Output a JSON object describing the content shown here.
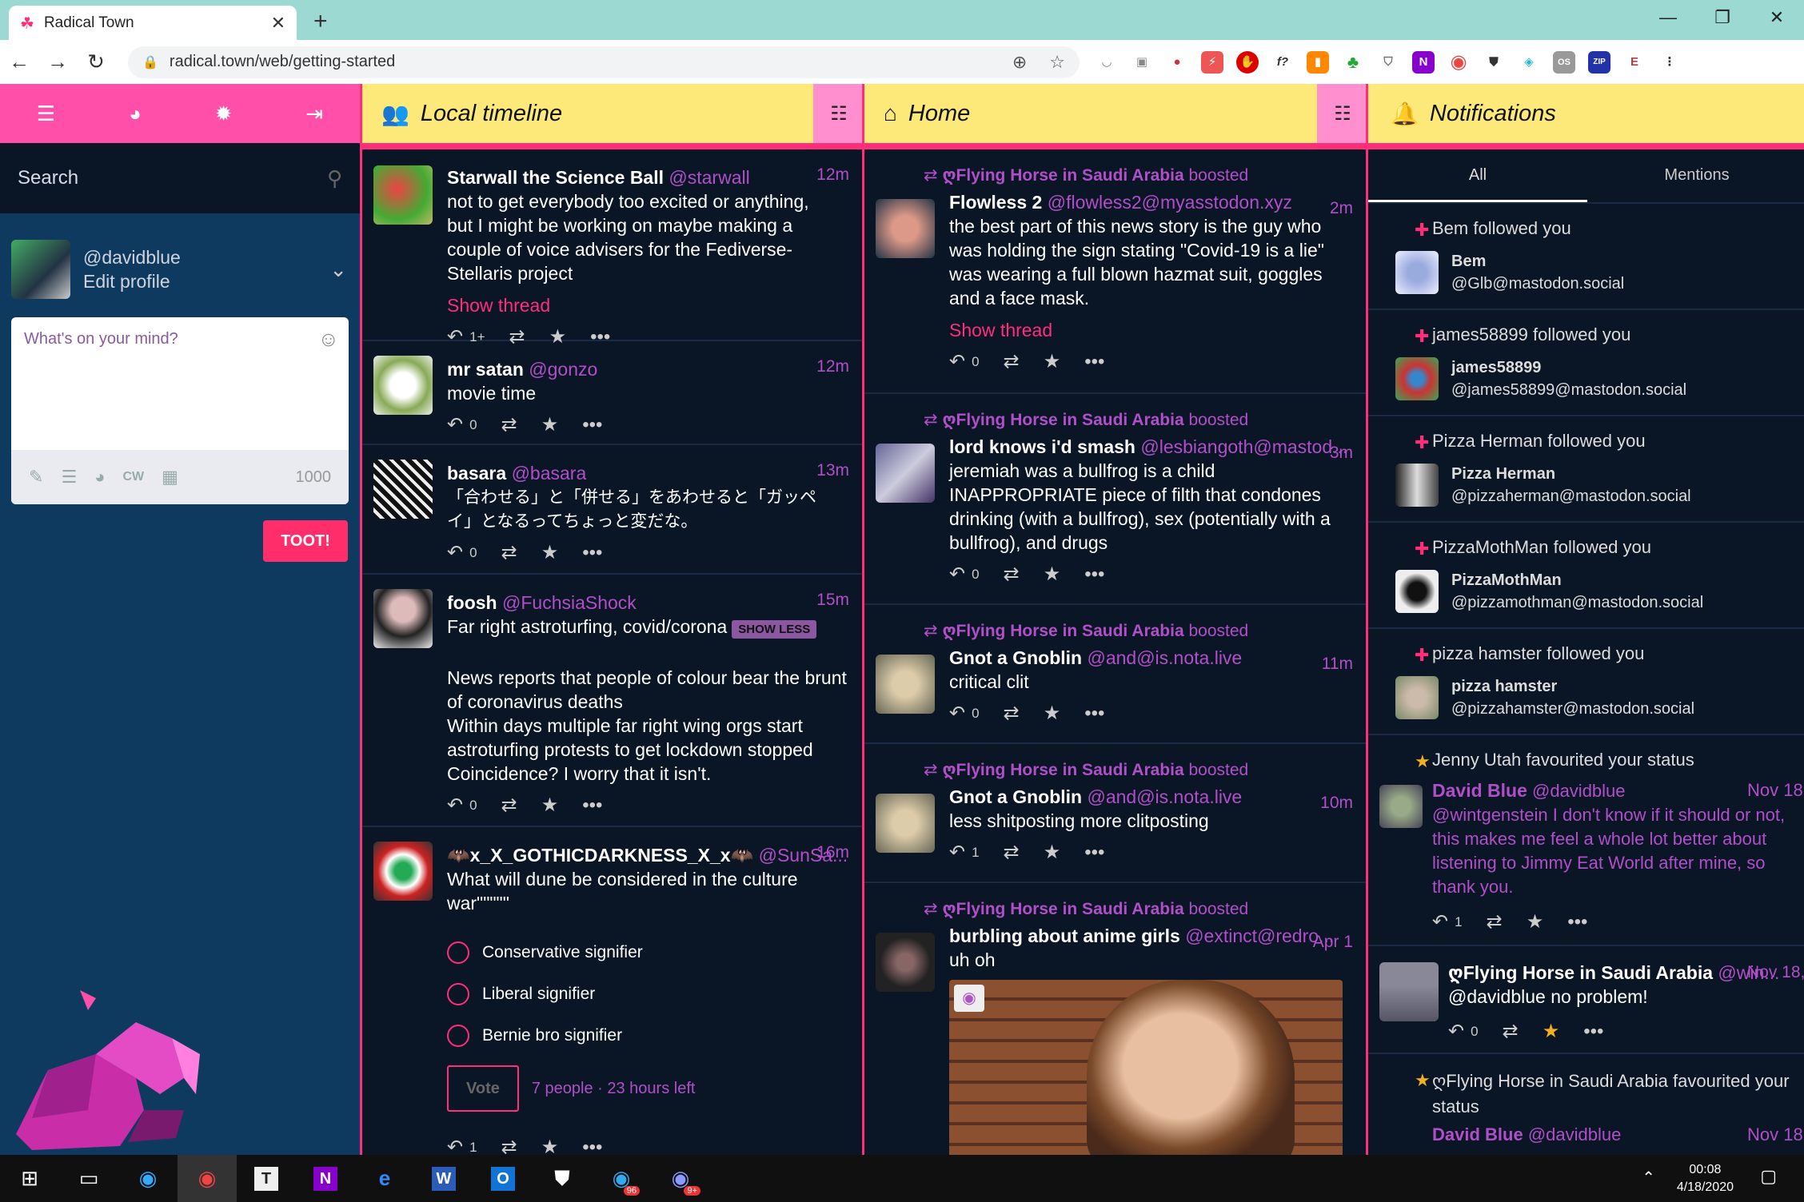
{
  "browser": {
    "tab_title": "Radical Town",
    "url": "radical.town/web/getting-started"
  },
  "left": {
    "search_placeholder": "Search",
    "handle": "@davidblue",
    "edit_profile": "Edit profile",
    "compose_placeholder": "What's on your mind?",
    "cw_label": "CW",
    "char_count": "1000",
    "toot_label": "TOOT!"
  },
  "local": {
    "title": "Local timeline",
    "statuses": [
      {
        "name": "Starwall the Science Ball",
        "acct": "@starwall",
        "time": "12m",
        "text": "not to get everybody too excited or anything, but I might be working on maybe making a couple of voice advisers for the Fediverse-Stellaris project",
        "show_thread": "Show thread",
        "replies": "1+"
      },
      {
        "name": "mr satan",
        "acct": "@gonzo",
        "time": "12m",
        "text": "movie time",
        "replies": "0"
      },
      {
        "name": "basara",
        "acct": "@basara",
        "time": "13m",
        "text": "「合わせる」と「併せる」をあわせると「ガッペイ」となるってちょっと変だな。",
        "replies": "0"
      },
      {
        "name": "foosh",
        "acct": "@FuchsiaShock",
        "time": "15m",
        "cw": "Far right astroturfing, covid/corona",
        "cw_button": "SHOW LESS",
        "text": "News reports that people of colour bear the brunt of coronavirus deaths",
        "text2": "Within days multiple far right wing orgs start astroturfing protests to get lockdown stopped",
        "text3": "Coincidence? I worry that it isn't.",
        "replies": "0"
      },
      {
        "name": "🦇x_X_GOTHICDARKNESS_X_x🦇",
        "acct": "@SunSa...",
        "time": "16m",
        "text": "What will dune be considered in the culture war\"\"\"\"\"",
        "poll": [
          "Conservative signifier",
          "Liberal signifier",
          "Bernie bro signifier"
        ],
        "vote": "Vote",
        "poll_meta": "7 people · 23 hours left",
        "replies": "1"
      }
    ]
  },
  "home": {
    "title": "Home",
    "boost_text": "boosted",
    "booster": "ღFlying Horse in Saudi Arabia",
    "statuses": [
      {
        "name": "Flowless 2",
        "acct": "@flowless2@myasstodon.xyz",
        "time": "2m",
        "text": "the best part of this news story is the guy who was holding the sign stating \"Covid-19 is a lie\" was wearing a full blown hazmat suit, goggles and a face mask.",
        "show_thread": "Show thread",
        "replies": "0"
      },
      {
        "name": "lord knows i'd smash",
        "acct": "@lesbiangoth@mastod...",
        "time": "3m",
        "text": "jeremiah was a bullfrog is a child INAPPROPRIATE piece of filth that condones drinking (with a bullfrog), sex (potentially with a bullfrog), and drugs",
        "replies": "0"
      },
      {
        "name": "Gnot a Gnoblin",
        "acct": "@and@is.nota.live",
        "time": "11m",
        "text": "critical clit",
        "replies": "0"
      },
      {
        "name": "Gnot a Gnoblin",
        "acct": "@and@is.nota.live",
        "time": "10m",
        "text": "less shitposting more clitposting",
        "replies": "1"
      },
      {
        "name": "burbling about anime girls",
        "acct": "@extinct@redro...",
        "time": "Apr 1",
        "text": "uh oh"
      }
    ]
  },
  "notifications": {
    "title": "Notifications",
    "tab_all": "All",
    "tab_mentions": "Mentions",
    "followed_text": "followed you",
    "follows": [
      {
        "name": "Bem",
        "acct": "@Glb@mastodon.social"
      },
      {
        "name": "james58899",
        "acct": "@james58899@mastodon.social"
      },
      {
        "name": "Pizza Herman",
        "acct": "@pizzaherman@mastodon.social"
      },
      {
        "name": "PizzaMothMan",
        "acct": "@pizzamothman@mastodon.social"
      },
      {
        "name": "pizza hamster",
        "acct": "@pizzahamster@mastodon.social"
      }
    ],
    "fav1": {
      "who": "Jenny Utah",
      "text": "favourited your status",
      "author": "David Blue",
      "acct": "@davidblue",
      "time": "Nov 18,",
      "body": "@wintgenstein I don't know if it should or not, this makes me feel a whole lot better about listening to Jimmy Eat World after mine, so thank you.",
      "replies": "1"
    },
    "reply": {
      "author": "ღFlying Horse in Saudi Arabia",
      "acct": "@win...",
      "time": "Nov 18,",
      "body_mention": "@davidblue",
      "body": "no problem!",
      "replies": "0"
    },
    "fav2": {
      "who": "ღFlying Horse in Saudi Arabia",
      "text": "favourited your status",
      "author": "David Blue",
      "acct": "@davidblue",
      "time": "Nov 18,"
    }
  },
  "taskbar": {
    "time": "00:08",
    "date": "4/18/2020",
    "telegram_badge": "96",
    "discord_badge": "9+"
  },
  "colors": {
    "pink": "#ff4fa8",
    "yellow": "#fde97a",
    "purple": "#b04fc8",
    "bg": "#0a1526"
  }
}
